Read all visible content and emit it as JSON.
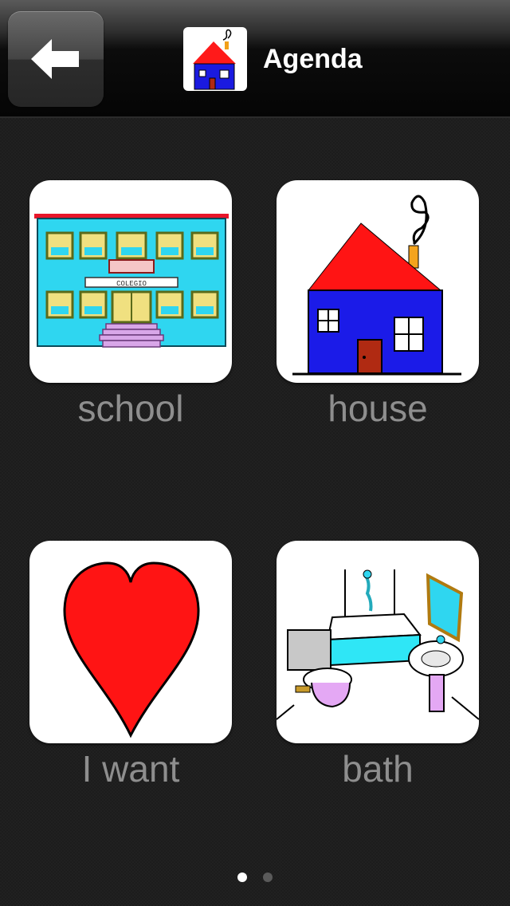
{
  "header": {
    "title": "Agenda",
    "back_icon": "arrow-left-icon",
    "icon": "house-icon"
  },
  "tiles": [
    {
      "label": "school",
      "icon": "school-building-icon"
    },
    {
      "label": "house",
      "icon": "house-icon"
    },
    {
      "label": "I want",
      "icon": "heart-icon"
    },
    {
      "label": "bath",
      "icon": "bathroom-icon"
    }
  ],
  "pagination": {
    "page_count": 2,
    "current_page": 1
  },
  "colors": {
    "background": "#1c1c1c",
    "label": "#8e8e8e",
    "title": "#ffffff"
  }
}
